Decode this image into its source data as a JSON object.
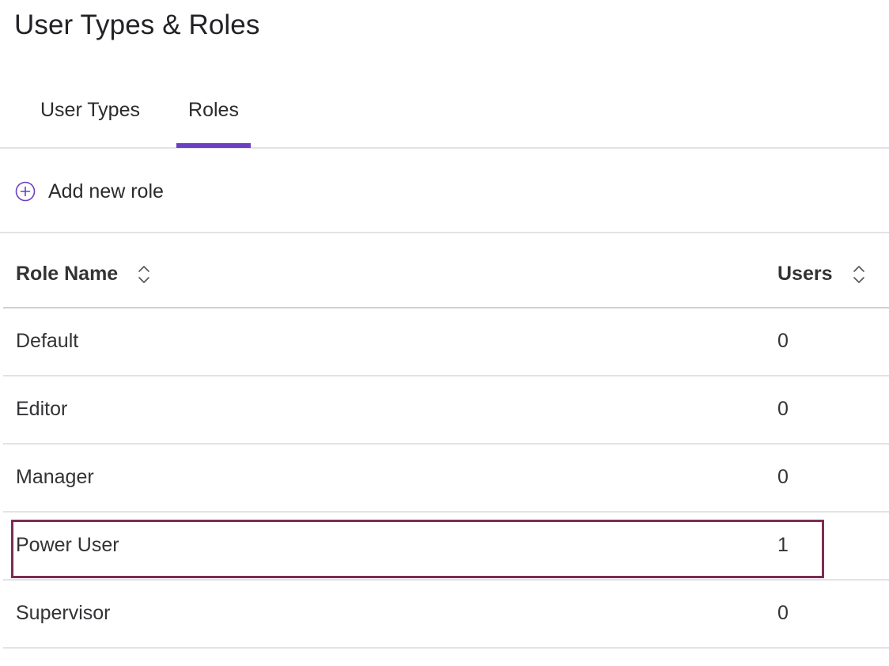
{
  "page": {
    "title": "User Types & Roles"
  },
  "tabs": [
    {
      "label": "User Types",
      "active": false
    },
    {
      "label": "Roles",
      "active": true
    }
  ],
  "actions": {
    "add_role_label": "Add new role",
    "add_role_icon": "plus-circle-icon"
  },
  "table": {
    "columns": [
      {
        "label": "Role Name",
        "sort_icon": "sort-updown-icon"
      },
      {
        "label": "Users",
        "sort_icon": "sort-updown-icon"
      }
    ],
    "rows": [
      {
        "name": "Default",
        "users": "0"
      },
      {
        "name": "Editor",
        "users": "0"
      },
      {
        "name": "Manager",
        "users": "0"
      },
      {
        "name": "Power User",
        "users": "1",
        "highlighted": true
      },
      {
        "name": "Supervisor",
        "users": "0"
      }
    ]
  },
  "colors": {
    "accent": "#6b3fc4",
    "highlight_border": "#7b2d55",
    "divider": "#e3e3e6",
    "text": "#2b2b2e"
  }
}
